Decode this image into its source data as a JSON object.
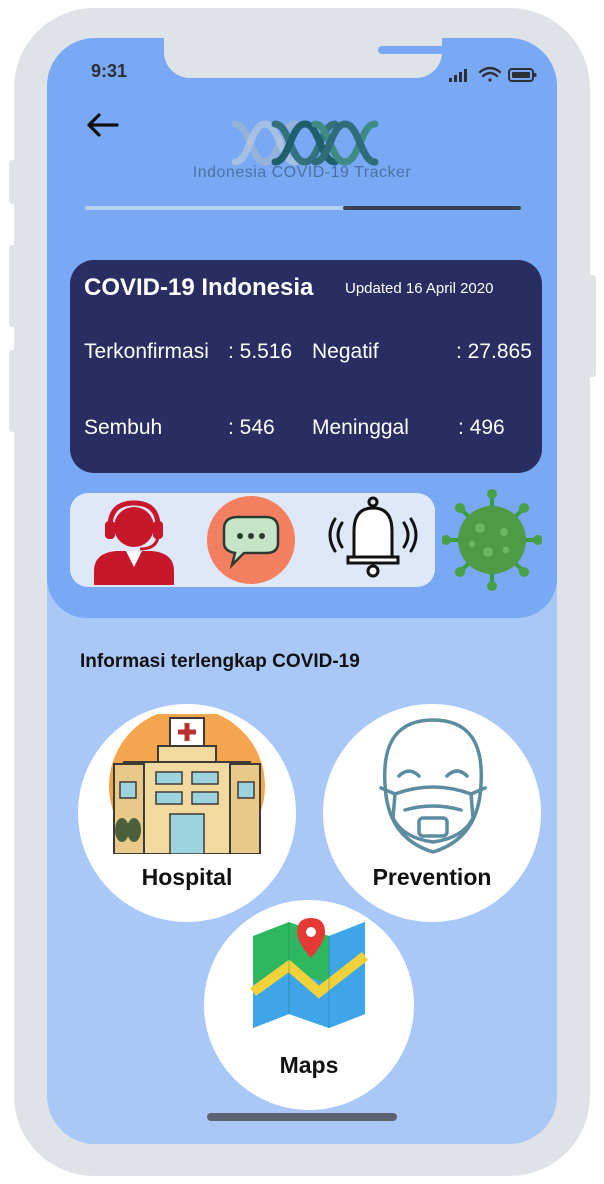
{
  "status_bar": {
    "time": "9:31"
  },
  "header": {
    "logo_text": "Indonesia COVID-19 Tracker",
    "progress": 0.41
  },
  "stats_card": {
    "title": "COVID-19 Indonesia",
    "updated": "Updated 16 April 2020",
    "stats": [
      {
        "label": "Terkonfirmasi",
        "value": ": 5.516"
      },
      {
        "label": "Negatif",
        "value": ": 27.865"
      },
      {
        "label": "Sembuh",
        "value": ": 546"
      },
      {
        "label": "Meninggal",
        "value": ": 496"
      }
    ]
  },
  "quick_icons": [
    "call-center-icon",
    "chat-icon",
    "notification-bell-icon",
    "virus-icon"
  ],
  "section": {
    "title": "Informasi terlengkap COVID-19"
  },
  "features": [
    {
      "label": "Hospital",
      "icon": "hospital-icon"
    },
    {
      "label": "Prevention",
      "icon": "face-mask-icon"
    },
    {
      "label": "Maps",
      "icon": "map-icon"
    }
  ],
  "colors": {
    "panel": "#79a8f4",
    "background": "#a9c8f7",
    "card": "#2a2d62"
  }
}
